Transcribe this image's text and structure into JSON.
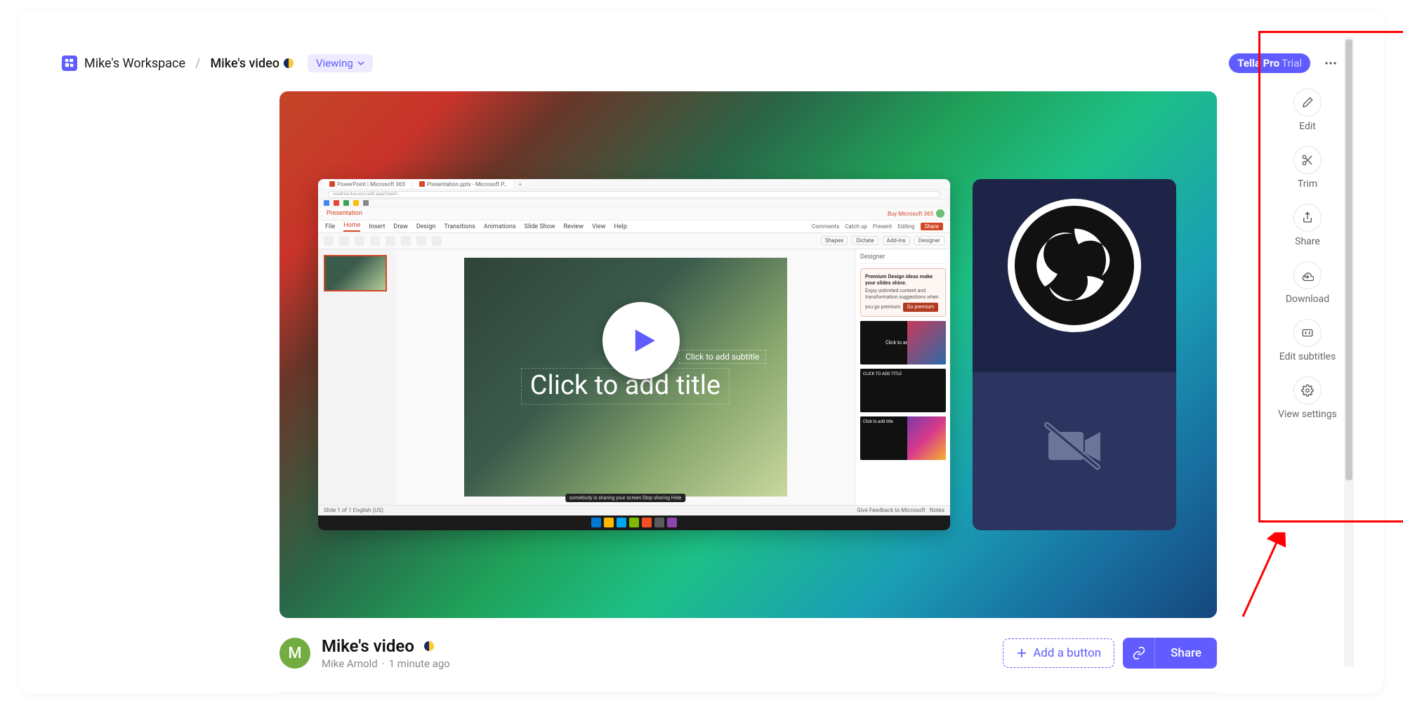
{
  "breadcrumb": {
    "workspace": "Mike's Workspace",
    "video": "Mike's video"
  },
  "viewing_label": "Viewing",
  "pro_badge": {
    "label": "Tella Pro",
    "suffix": "Trial"
  },
  "ppt": {
    "tab1": "PowerPoint | Microsoft 365",
    "tab2": "Presentation.pptx - Microsoft P…",
    "file_label": "Presentation",
    "buy": "Buy Microsoft 365",
    "ribbon": {
      "file": "File",
      "home": "Home",
      "insert": "Insert",
      "draw": "Draw",
      "design": "Design",
      "transitions": "Transitions",
      "animations": "Animations",
      "slideshow": "Slide Show",
      "review": "Review",
      "view": "View",
      "help": "Help"
    },
    "ribbon_right": {
      "comments": "Comments",
      "catchup": "Catch up",
      "present": "Present",
      "editing": "Editing",
      "share": "Share"
    },
    "toolbar_right": {
      "shapes": "Shapes",
      "dictate": "Dictate",
      "addins": "Add-ins",
      "designer": "Designer"
    },
    "subtitle_placeholder": "Click to add subtitle",
    "title_placeholder": "Click to add title",
    "designer_header": "Designer",
    "premium_head": "Premium Design ideas make your slides shine.",
    "premium_body": "Enjoy unlimited content and transformation suggestions when you go premium.",
    "go_premium": "Go premium",
    "suggest_text": "Click to add title",
    "status_left": "Slide 1 of 1    English (US)",
    "status_feedback": "Give Feedback to Microsoft",
    "status_notes": "Notes",
    "share_strip": "somebody is sharing your screen   Stop sharing   Hide"
  },
  "info": {
    "avatar_initial": "M",
    "title": "Mike's video",
    "author": "Mike Arnold",
    "time": "1 minute ago"
  },
  "buttons": {
    "add": "Add a button",
    "share": "Share"
  },
  "sidebar": {
    "items": [
      {
        "label": "Edit"
      },
      {
        "label": "Trim"
      },
      {
        "label": "Share"
      },
      {
        "label": "Download"
      },
      {
        "label": "Edit subtitles"
      },
      {
        "label": "View settings"
      }
    ]
  }
}
